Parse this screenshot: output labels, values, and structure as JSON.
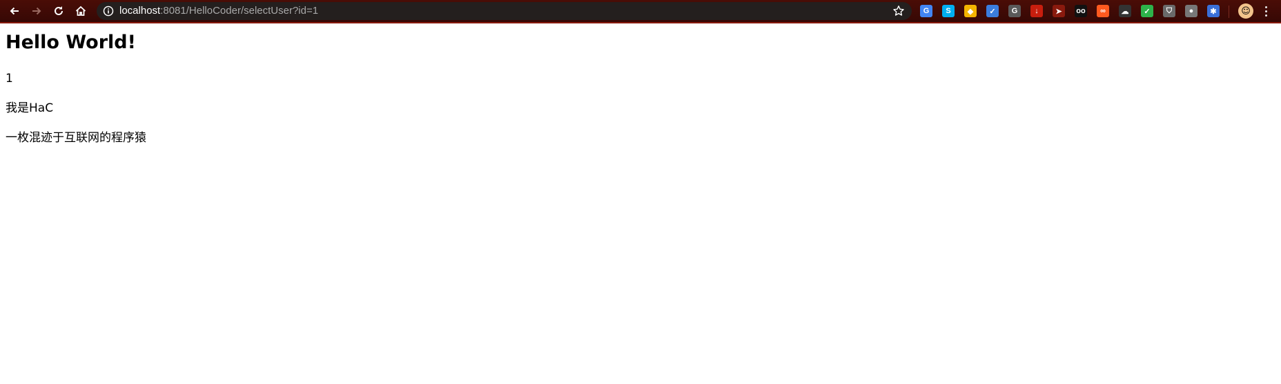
{
  "browser": {
    "url_host": "localhost",
    "url_path": ":8081/HelloCoder/selectUser?id=1",
    "icons": [
      "back-icon",
      "forward-icon",
      "reload-icon",
      "home-icon",
      "info-icon",
      "bookmark-star-icon"
    ],
    "extensions": [
      {
        "name": "google-translate-extension-icon",
        "color": "#4285f4",
        "glyph": "G"
      },
      {
        "name": "skype-extension-icon",
        "color": "#00aff0",
        "glyph": "S"
      },
      {
        "name": "color-picker-extension-icon",
        "color": "#f4b400",
        "glyph": "◆"
      },
      {
        "name": "bookmark-manager-extension-icon",
        "color": "#3b7ddd",
        "glyph": "✓"
      },
      {
        "name": "g-extension-icon",
        "color": "#5a5a5a",
        "glyph": "G"
      },
      {
        "name": "download-extension-icon",
        "color": "#c81e0e",
        "glyph": "↓"
      },
      {
        "name": "cursor-extension-icon",
        "color": "#8a1a0e",
        "glyph": "➤"
      },
      {
        "name": "glasses-extension-icon",
        "color": "#111111",
        "glyph": "oo"
      },
      {
        "name": "infinity-extension-icon",
        "color": "#ff5a1f",
        "glyph": "∞"
      },
      {
        "name": "cloud-extension-icon",
        "color": "#333333",
        "glyph": "☁"
      },
      {
        "name": "checkmark-extension-icon",
        "color": "#2db34a",
        "glyph": "✓"
      },
      {
        "name": "shield-extension-icon",
        "color": "#6a6a6a",
        "glyph": "⛉"
      },
      {
        "name": "apple-extension-icon",
        "color": "#777777",
        "glyph": "●"
      },
      {
        "name": "asterisk-extension-icon",
        "color": "#3a6fd8",
        "glyph": "✱"
      }
    ],
    "accent_color": "#4a0d06"
  },
  "page": {
    "heading": "Hello World!",
    "id_value": "1",
    "intro": "我是HaC",
    "tagline": "一枚混迹于互联网的程序猿"
  }
}
